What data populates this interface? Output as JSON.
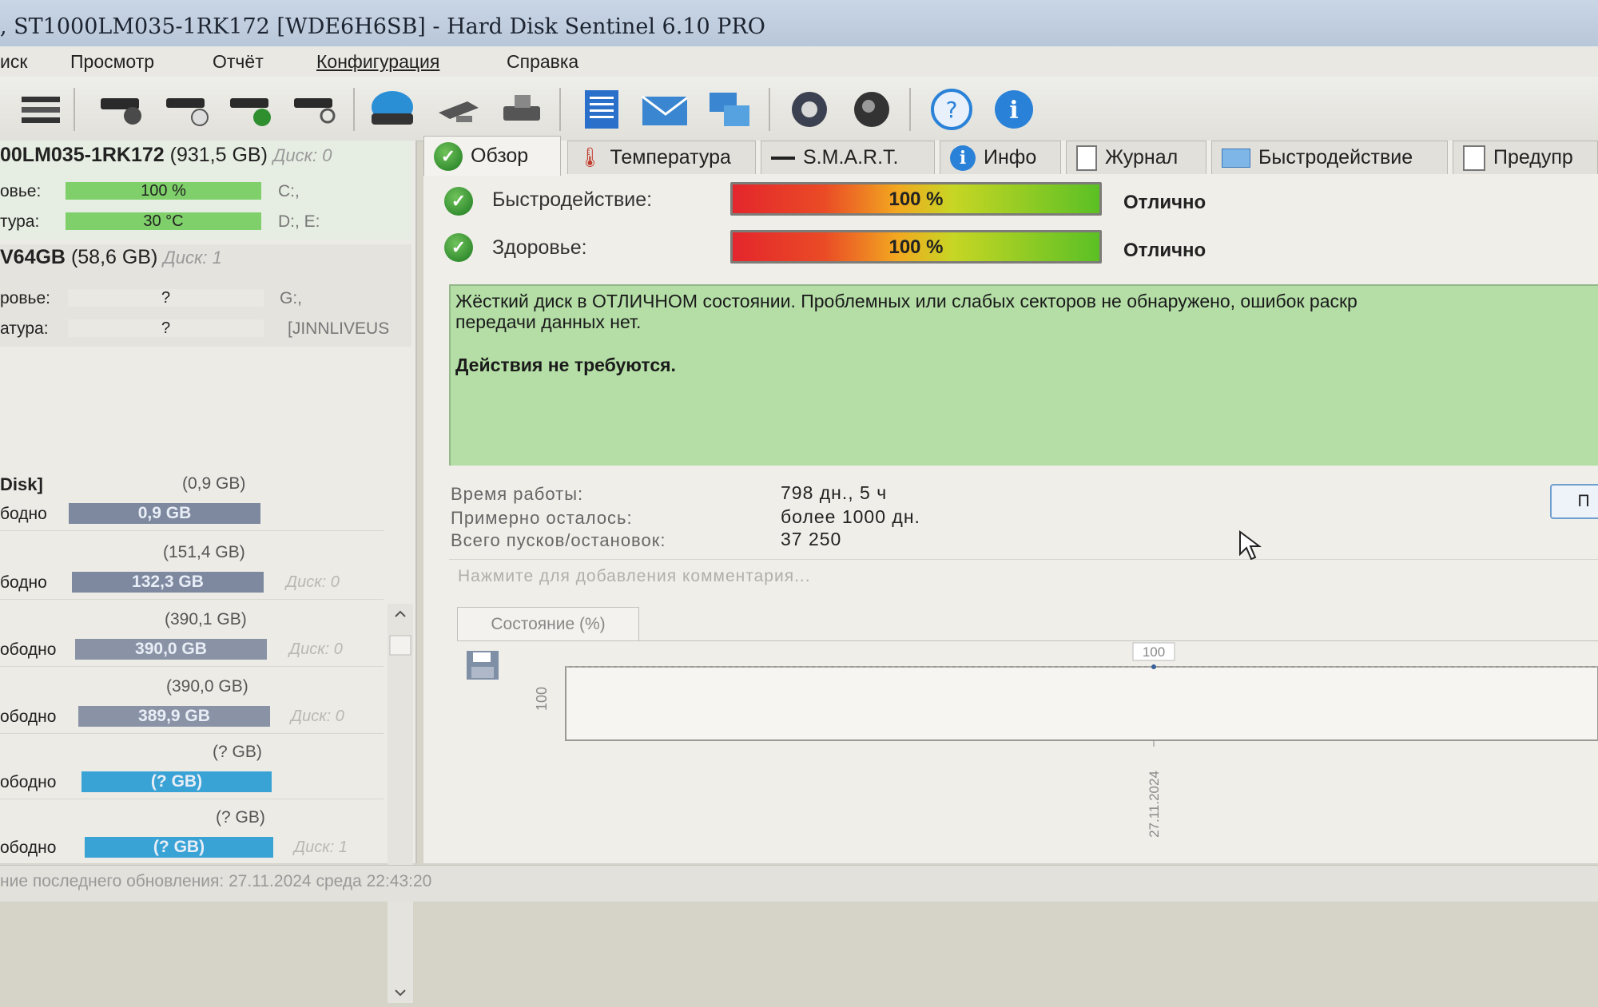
{
  "window": {
    "title": ", ST1000LM035-1RK172 [WDE6H6SB]  -  Hard Disk Sentinel 6.10 PRO"
  },
  "menu": [
    "иск",
    "Просмотр",
    "Отчёт",
    "Конфигурация",
    "Справка"
  ],
  "toolbar": {
    "icons": [
      "menu-icon",
      "disk-refresh-icon",
      "disk-schedule-icon",
      "disk-check-icon",
      "disk-search-icon",
      "globe-icon",
      "satellite-icon",
      "printer-icon",
      "report-icon",
      "mail-icon",
      "network-icon",
      "settings-icon",
      "disk-sound-icon",
      "help-icon",
      "info-icon"
    ]
  },
  "left": {
    "disk1": {
      "name": "00LM035-1RK172",
      "size": "(931,5 GB)",
      "disk_no": "Диск: 0",
      "health_label": "овье:",
      "health_value": "100 %",
      "health_fraction": 1.0,
      "temp_label": "тура:",
      "temp_value": "30 °C",
      "drive1": "C:,",
      "drive2": "D:, E:"
    },
    "disk2": {
      "name": "V64GB",
      "size": "(58,6 GB)",
      "disk_no": "Диск: 1",
      "health_label": "ровье:",
      "health_value": "?",
      "temp_label": "атура:",
      "temp_value": "?",
      "drive1": "G:,",
      "drive2": "[JINNLIVEUS"
    },
    "volumes": [
      {
        "name": "Disk]",
        "size": "(0,9 GB)",
        "free_label": "бодно",
        "free": "0,9 GB",
        "disk": "",
        "color": "#7e89a0"
      },
      {
        "name": "",
        "size": "(151,4 GB)",
        "free_label": "бодно",
        "free": "132,3 GB",
        "disk": "Диск: 0",
        "color": "#7e89a0"
      },
      {
        "name": "",
        "size": "(390,1 GB)",
        "free_label": "ободно",
        "free": "390,0 GB",
        "disk": "Диск: 0",
        "color": "#8a93a6"
      },
      {
        "name": "",
        "size": "(390,0 GB)",
        "free_label": "ободно",
        "free": "389,9 GB",
        "disk": "Диск: 0",
        "color": "#8a93a6"
      },
      {
        "name": "",
        "size": "(? GB)",
        "free_label": "ободно",
        "free": "(? GB)",
        "disk": "",
        "color": "#3aa3d6"
      },
      {
        "name": "",
        "size": "(? GB)",
        "free_label": "ободно",
        "free": "(? GB)",
        "disk": "Диск: 1",
        "color": "#3aa3d6"
      }
    ]
  },
  "tabs": [
    {
      "label": "Обзор",
      "icon": "check-icon"
    },
    {
      "label": "Температура",
      "icon": "thermometer-icon"
    },
    {
      "label": "S.M.A.R.T.",
      "icon": "dash-icon"
    },
    {
      "label": "Инфо",
      "icon": "info-icon"
    },
    {
      "label": "Журнал",
      "icon": "document-icon"
    },
    {
      "label": "Быстродействие",
      "icon": "performance-icon"
    },
    {
      "label": "Предупр",
      "icon": "copy-icon"
    }
  ],
  "overview": {
    "performance_label": "Быстродействие:",
    "performance_value": "100 %",
    "performance_fraction": 1.0,
    "performance_word": "Отлично",
    "health_label": "Здоровье:",
    "health_value": "100 %",
    "health_fraction": 1.0,
    "health_word": "Отлично",
    "message_line1": "Жёсткий диск в ОТЛИЧНОМ состоянии. Проблемных или слабых секторов не обнаружено, ошибок раскр",
    "message_line2": "передачи данных нет.",
    "message_action": "Действия не требуются.",
    "uptime_label": "Время работы:",
    "uptime_value": "798 дн., 5 ч",
    "remaining_label": "Примерно осталось:",
    "remaining_value": "более 1000 дн.",
    "starts_label": "Всего пусков/остановок:",
    "starts_value": "37 250",
    "comment_placeholder": "Нажмите для добавления комментария...",
    "button_label": "П",
    "state_tab": "Состояние (%)"
  },
  "chart_data": {
    "type": "line",
    "x": [
      "27.11.2024"
    ],
    "series": [
      {
        "values": [
          100
        ]
      }
    ],
    "ylabel": "",
    "ytick": "100",
    "point_label": "100"
  },
  "statusbar": {
    "text": "ние последнего обновления: 27.11.2024 среда 22:43:20"
  }
}
